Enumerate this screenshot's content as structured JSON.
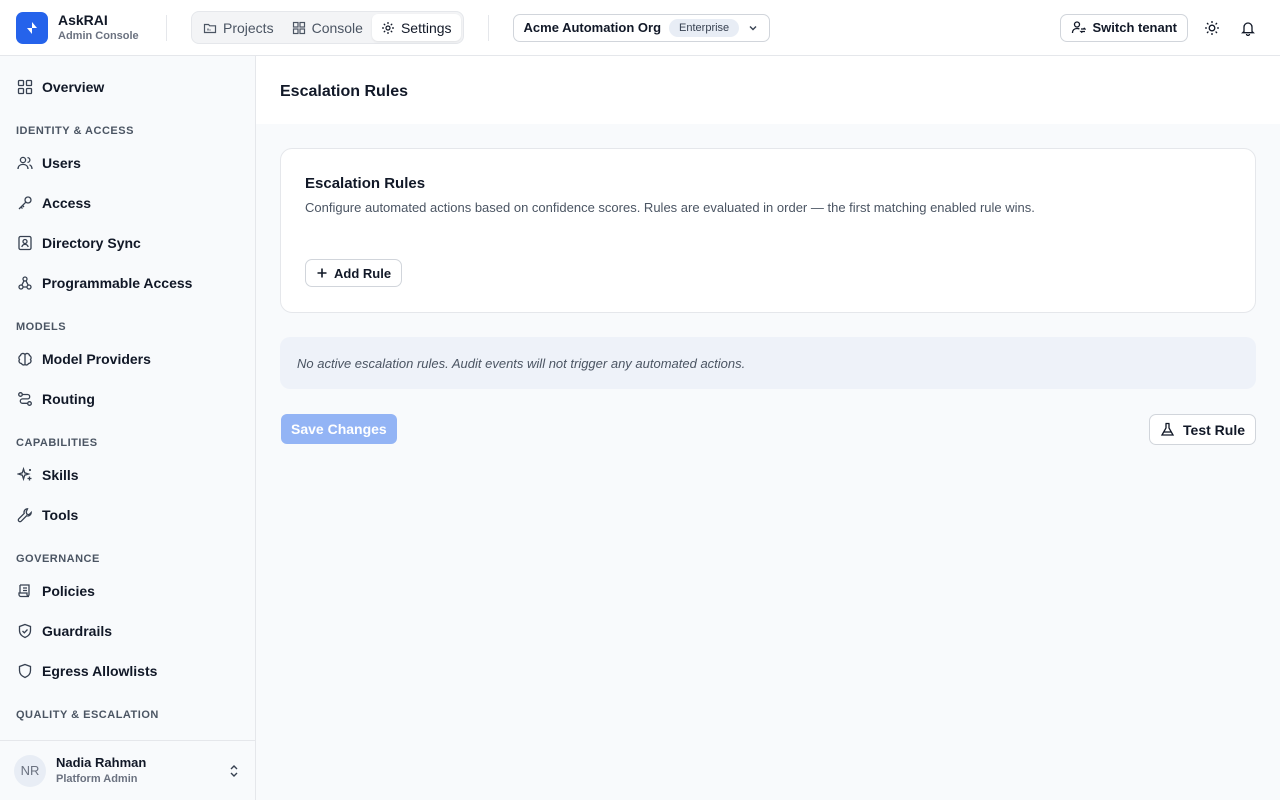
{
  "header": {
    "brand_name": "AskRAI",
    "brand_sub": "Admin Console",
    "tabs": [
      {
        "label": "Projects",
        "icon": "folder-icon"
      },
      {
        "label": "Console",
        "icon": "grid-icon"
      },
      {
        "label": "Settings",
        "icon": "gear-icon",
        "active": true
      }
    ],
    "org_name": "Acme Automation Org",
    "org_badge": "Enterprise",
    "switch_tenant": "Switch tenant"
  },
  "sidebar": {
    "overview": "Overview",
    "sections": {
      "identity": "IDENTITY & ACCESS",
      "models": "MODELS",
      "capabilities": "CAPABILITIES",
      "governance": "GOVERNANCE",
      "quality": "QUALITY & ESCALATION"
    },
    "items": {
      "users": "Users",
      "access": "Access",
      "directory_sync": "Directory Sync",
      "programmable_access": "Programmable Access",
      "model_providers": "Model Providers",
      "routing": "Routing",
      "skills": "Skills",
      "tools": "Tools",
      "policies": "Policies",
      "guardrails": "Guardrails",
      "egress_allowlists": "Egress Allowlists"
    },
    "user": {
      "initials": "NR",
      "name": "Nadia Rahman",
      "role": "Platform Admin"
    }
  },
  "main": {
    "page_title": "Escalation Rules",
    "card_title": "Escalation Rules",
    "card_desc": "Configure automated actions based on confidence scores. Rules are evaluated in order — the first matching enabled rule wins.",
    "add_rule": "Add Rule",
    "notice": "No active escalation rules. Audit events will not trigger any automated actions.",
    "save_changes": "Save Changes",
    "test_rule": "Test Rule"
  },
  "colors": {
    "accent": "#2563eb",
    "save_disabled": "#93b4f5",
    "notice_bg": "#eef2f9"
  }
}
